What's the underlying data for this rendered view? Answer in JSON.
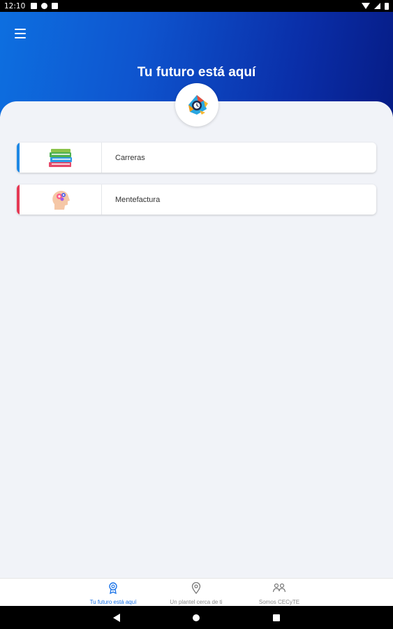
{
  "status_bar": {
    "time": "12:10"
  },
  "header": {
    "title": "Tu futuro está aquí"
  },
  "cards": [
    {
      "label": "Carreras",
      "accent_color": "#1e88e5",
      "icon": "books-icon"
    },
    {
      "label": "Mentefactura",
      "accent_color": "#e53955",
      "icon": "head-gears-icon"
    }
  ],
  "bottom_nav": [
    {
      "label": "Tu futuro está aquí",
      "icon": "award-icon",
      "active": true
    },
    {
      "label": "Un plantel cerca de ti",
      "icon": "location-pin-icon",
      "active": false
    },
    {
      "label": "Somos CECyTE",
      "icon": "people-icon",
      "active": false
    }
  ],
  "colors": {
    "accent": "#1a73e8",
    "header_start": "#0d6fe0",
    "header_end": "#061c86"
  }
}
